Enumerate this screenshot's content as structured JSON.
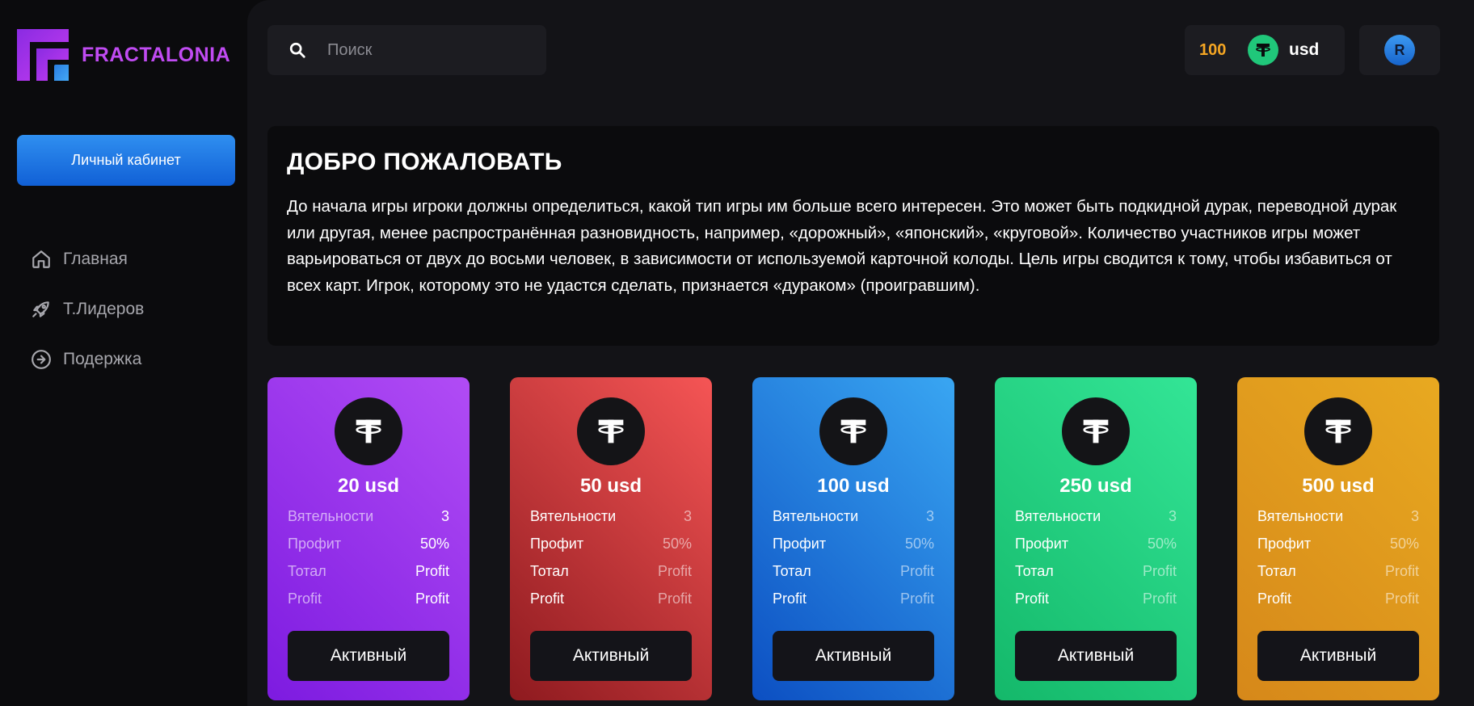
{
  "brand": {
    "name": "FRACTALONIA"
  },
  "sidebar": {
    "cabinet_label": "Личный кабинет",
    "items": [
      {
        "label": "Главная",
        "icon": "home-icon"
      },
      {
        "label": "Т.Лидеров",
        "icon": "rocket-icon"
      },
      {
        "label": "Подержка",
        "icon": "arrow-right-circle-icon"
      }
    ]
  },
  "header": {
    "search_placeholder": "Поиск",
    "balance_amount": "100",
    "balance_currency": "usd",
    "avatar_letter": "R"
  },
  "welcome": {
    "title": "ДОБРО ПОЖАЛОВАТЬ",
    "text": "До начала игры игроки должны определиться, какой тип игры им больше всего интересен. Это может быть подкидной дурак, переводной дурак или другая, менее распространённая разновидность, например, «дорожный», «японский», «круговой». Количество участников игры может варьироваться от двух до восьми человек, в зависимости от используемой карточной колоды. Цель игры сводится к тому, чтобы избавиться от всех карт. Игрок, которому это не удастся сделать, признается «дураком» (проигравшим)."
  },
  "colors": {
    "purple": "#9b3cf0",
    "red": "#d8373a",
    "blue": "#2a86e6",
    "green": "#22cf7f",
    "orange": "#e49c18"
  },
  "cards": [
    {
      "amount": "20 usd",
      "rows": [
        [
          "Вятельности",
          "3"
        ],
        [
          "Профит",
          "50%"
        ],
        [
          "Тотал",
          "Profit"
        ],
        [
          "Profit",
          "Profit"
        ]
      ],
      "button": "Активный"
    },
    {
      "amount": "50 usd",
      "rows": [
        [
          "Вятельности",
          "3"
        ],
        [
          "Профит",
          "50%"
        ],
        [
          "Тотал",
          "Profit"
        ],
        [
          "Profit",
          "Profit"
        ]
      ],
      "button": "Активный"
    },
    {
      "amount": "100 usd",
      "rows": [
        [
          "Вятельности",
          "3"
        ],
        [
          "Профит",
          "50%"
        ],
        [
          "Тотал",
          "Profit"
        ],
        [
          "Profit",
          "Profit"
        ]
      ],
      "button": "Активный"
    },
    {
      "amount": "250 usd",
      "rows": [
        [
          "Вятельности",
          "3"
        ],
        [
          "Профит",
          "50%"
        ],
        [
          "Тотал",
          "Profit"
        ],
        [
          "Profit",
          "Profit"
        ]
      ],
      "button": "Активный"
    },
    {
      "amount": "500 usd",
      "rows": [
        [
          "Вятельности",
          "3"
        ],
        [
          "Профит",
          "50%"
        ],
        [
          "Тотал",
          "Profit"
        ],
        [
          "Profit",
          "Profit"
        ]
      ],
      "button": "Активный"
    }
  ]
}
